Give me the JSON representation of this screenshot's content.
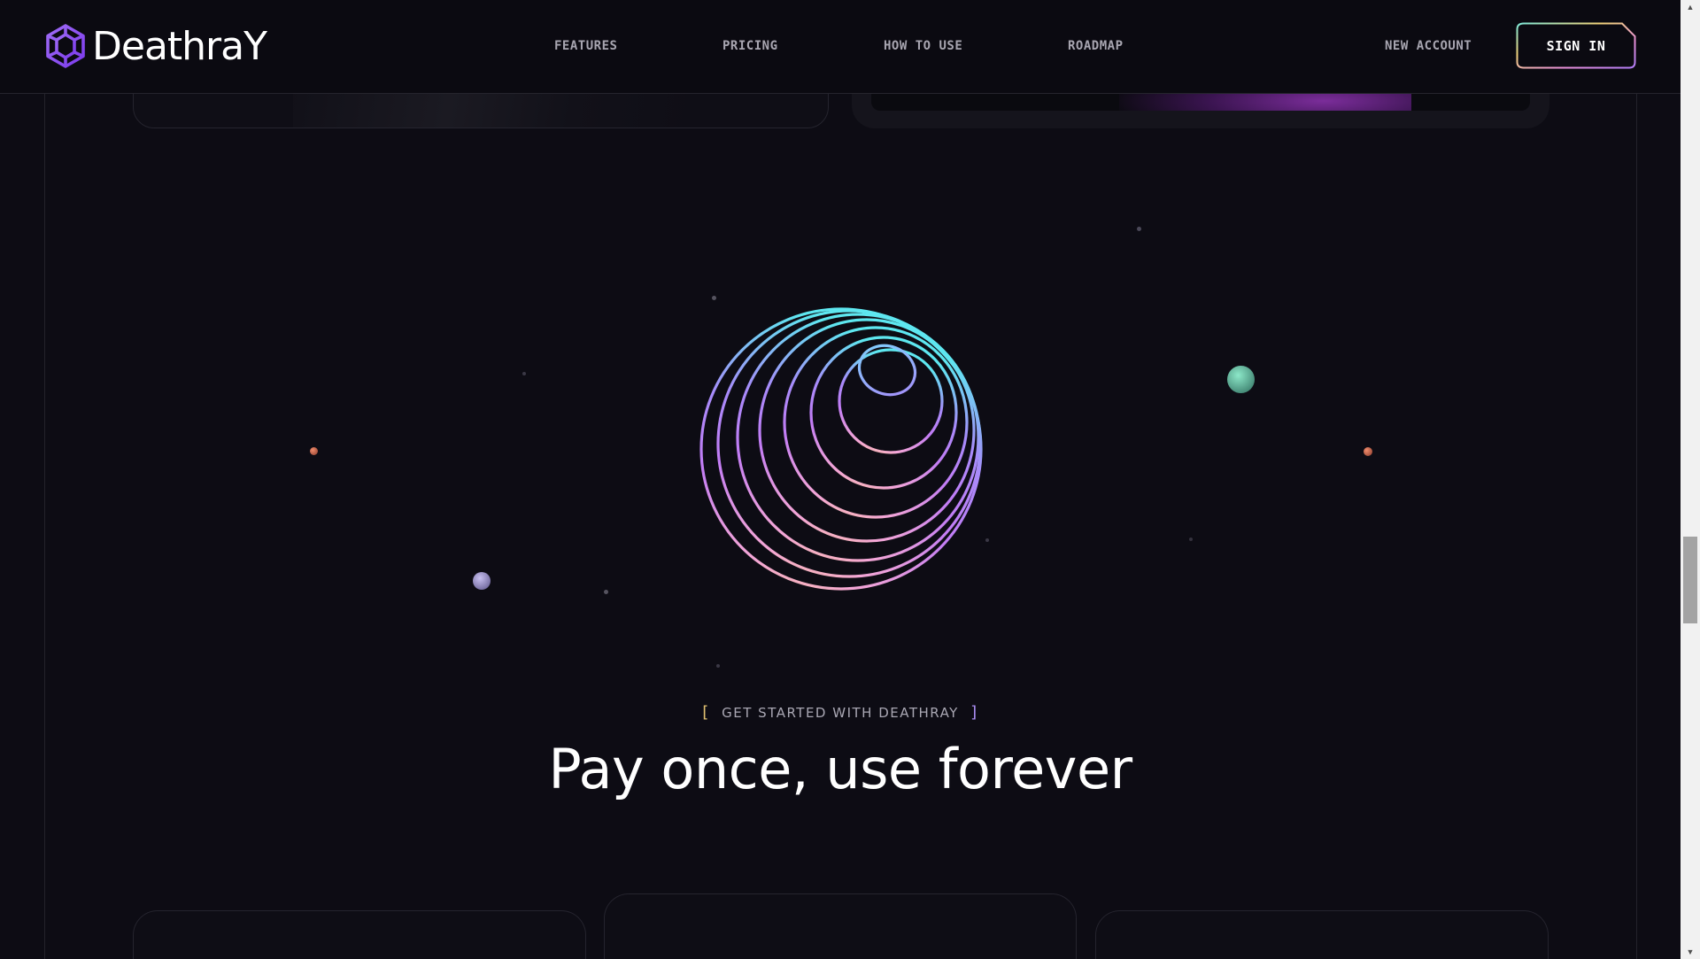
{
  "brand": {
    "name": "DeathraY",
    "logo_icon": "hex-knot-icon",
    "accent": "#8b5cf6"
  },
  "nav": {
    "features": "FEATURES",
    "pricing": "PRICING",
    "how_to_use": "HOW TO USE",
    "roadmap": "ROADMAP"
  },
  "actions": {
    "new_account": "NEW ACCOUNT",
    "sign_in": "SIGN IN"
  },
  "hero": {
    "eyebrow_open": "[",
    "eyebrow": "GET STARTED WITH DEATHRAY",
    "eyebrow_close": "]",
    "headline": "Pay once, use forever",
    "graphic": "gradient-ring-sphere"
  },
  "colors": {
    "background": "#0d0c14",
    "gradient": [
      "#6ee7f9",
      "#a78bfa",
      "#c084fc",
      "#f0abfc",
      "#fbbf77"
    ]
  },
  "scrollbar": {
    "up_icon": "triangle-up-icon",
    "down_icon": "triangle-down-icon"
  }
}
